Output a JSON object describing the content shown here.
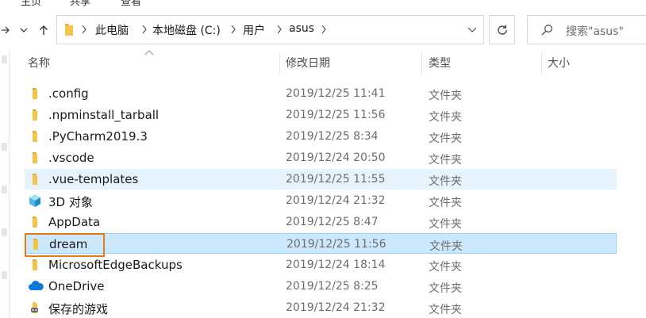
{
  "menu": {
    "items": [
      "主页",
      "共享",
      "查看"
    ]
  },
  "address": {
    "crumbs": [
      "此电脑",
      "本地磁盘 (C:)",
      "用户",
      "asus"
    ]
  },
  "search": {
    "placeholder": "搜索\"asus\""
  },
  "columns": {
    "name": "名称",
    "modified": "修改日期",
    "type": "类型",
    "size": "大小"
  },
  "rows": [
    {
      "name": ".config",
      "date": "2019/12/25 11:41",
      "type": "文件夹",
      "icon": "folder-icon",
      "state": ""
    },
    {
      "name": ".npminstall_tarball",
      "date": "2019/12/25 11:56",
      "type": "文件夹",
      "icon": "folder-icon",
      "state": ""
    },
    {
      "name": ".PyCharm2019.3",
      "date": "2019/12/25 8:34",
      "type": "文件夹",
      "icon": "folder-icon",
      "state": ""
    },
    {
      "name": ".vscode",
      "date": "2019/12/24 20:50",
      "type": "文件夹",
      "icon": "folder-icon",
      "state": ""
    },
    {
      "name": ".vue-templates",
      "date": "2019/12/25 11:55",
      "type": "文件夹",
      "icon": "folder-icon",
      "state": "hover"
    },
    {
      "name": "3D 对象",
      "date": "2019/12/24 21:32",
      "type": "文件夹",
      "icon": "3d-objects-icon",
      "state": ""
    },
    {
      "name": "AppData",
      "date": "2019/12/25 8:47",
      "type": "文件夹",
      "icon": "folder-icon",
      "state": ""
    },
    {
      "name": "dream",
      "date": "2019/12/25 11:56",
      "type": "文件夹",
      "icon": "folder-icon",
      "state": "selected"
    },
    {
      "name": "MicrosoftEdgeBackups",
      "date": "2019/12/24 18:14",
      "type": "文件夹",
      "icon": "folder-icon",
      "state": ""
    },
    {
      "name": "OneDrive",
      "date": "2019/12/25 8:25",
      "type": "文件夹",
      "icon": "onedrive-icon",
      "state": ""
    },
    {
      "name": "保存的游戏",
      "date": "2019/12/24 21:32",
      "type": "文件夹",
      "icon": "saved-games-icon",
      "state": ""
    }
  ],
  "colors": {
    "selected_bg": "#cce8ff",
    "selected_border": "#99d1ff",
    "hover_bg": "#e5f3ff",
    "folder": "#f3c54a",
    "highlight_outline": "#e07b1a"
  }
}
